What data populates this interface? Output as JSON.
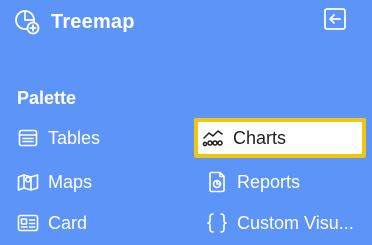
{
  "header": {
    "title": "Treemap",
    "app_icon": "chart-add-icon",
    "collapse_icon": "collapse-arrow-icon"
  },
  "palette": {
    "title": "Palette",
    "items": [
      {
        "label": "Tables",
        "icon": "table-icon",
        "selected": false
      },
      {
        "label": "Charts",
        "icon": "chart-icon",
        "selected": true
      },
      {
        "label": "Maps",
        "icon": "map-icon",
        "selected": false
      },
      {
        "label": "Reports",
        "icon": "report-icon",
        "selected": false
      },
      {
        "label": "Card",
        "icon": "card-icon",
        "selected": false
      },
      {
        "label": "Custom Visu...",
        "icon": "braces-icon",
        "selected": false
      }
    ]
  },
  "colors": {
    "background": "#5c95f7",
    "text": "#ffffff",
    "selected_background": "#ffffff",
    "selected_border": "#f2c511",
    "selected_text": "#1f1f1f"
  }
}
